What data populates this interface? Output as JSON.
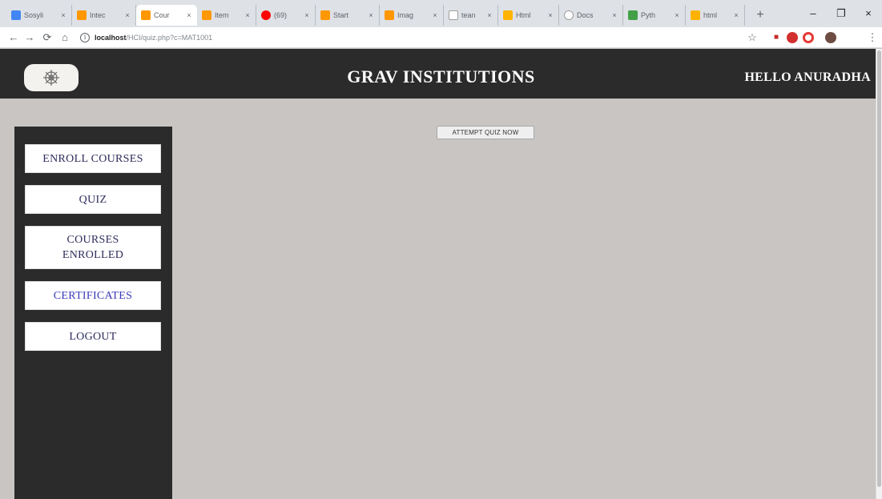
{
  "browser": {
    "tabs": [
      {
        "title": "Sosyli",
        "favicon_color": "#4285f4",
        "active": false
      },
      {
        "title": "Intec",
        "favicon_color": "#ff9800",
        "active": false
      },
      {
        "title": "Cour",
        "favicon_color": "#ff9800",
        "active": true
      },
      {
        "title": "Item",
        "favicon_color": "#ff9800",
        "active": false
      },
      {
        "title": "(69)",
        "favicon_color": "#ff0000",
        "active": false
      },
      {
        "title": "Start",
        "favicon_color": "#ff9800",
        "active": false
      },
      {
        "title": "Imag",
        "favicon_color": "#ff9800",
        "active": false
      },
      {
        "title": "tean",
        "favicon_color": "#9e9e9e",
        "active": false
      },
      {
        "title": "Html",
        "favicon_color": "#ffb300",
        "active": false
      },
      {
        "title": "Docs",
        "favicon_color": "#9e9e9e",
        "active": false
      },
      {
        "title": "Pyth",
        "favicon_color": "#43a047",
        "active": false
      },
      {
        "title": "html",
        "favicon_color": "#ffb300",
        "active": false
      }
    ],
    "tab_close_glyph": "×",
    "new_tab_glyph": "+",
    "window_controls": {
      "minimize": "–",
      "maximize": "❐",
      "close": "×"
    },
    "nav": {
      "back": "←",
      "forward": "→",
      "reload": "⟳",
      "home": "⌂"
    },
    "url": {
      "host": "localhost",
      "path": "/HCI/quiz.php?c=MAT1001"
    },
    "star_glyph": "☆",
    "extension_icons": [
      "stop-icon",
      "record-icon",
      "opera-icon",
      "profile-icon"
    ]
  },
  "page": {
    "site_title": "GRAV INSTITUTIONS",
    "greeting": "HELLO ANURADHA",
    "logo_icon": "mandala-logo-icon",
    "sidebar": {
      "items": [
        {
          "label": "ENROLL COURSES",
          "color": "#2c2c5c"
        },
        {
          "label": "QUIZ",
          "color": "#2c2c5c"
        },
        {
          "label": "COURSES ENROLLED",
          "color": "#2c2c5c"
        },
        {
          "label": "CERTIFICATES",
          "color": "#3a3ab8"
        },
        {
          "label": "LOGOUT",
          "color": "#2c2c5c"
        }
      ]
    },
    "attempt_quiz_label": "ATTEMPT QUIZ NOW",
    "colors": {
      "header_bg": "#2b2b2b",
      "page_bg": "#c8c5c3",
      "sidebar_bg": "#2b2b2b"
    }
  }
}
